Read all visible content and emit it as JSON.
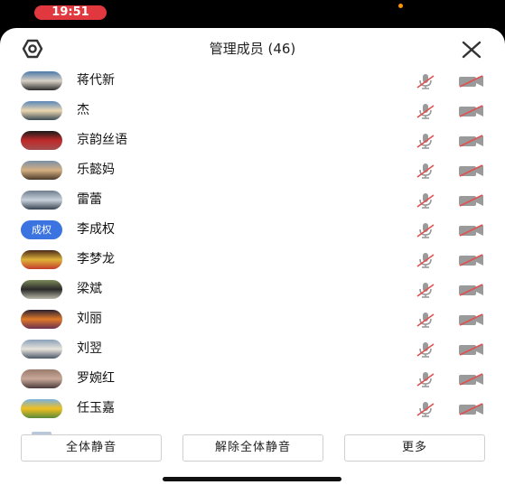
{
  "status_bar": {
    "time": "19:51"
  },
  "header": {
    "title": "管理成员 (46)"
  },
  "members": [
    {
      "name": "蒋代新",
      "avatar_colors": [
        "#4d78a8",
        "#d9d2c6",
        "#2c2c2c"
      ]
    },
    {
      "name": "杰",
      "avatar_colors": [
        "#5a86b8",
        "#ecd7b0",
        "#3b4b57"
      ]
    },
    {
      "name": "京韵丝语",
      "avatar_colors": [
        "#1a1a1a",
        "#c02a2a",
        "#a05050"
      ]
    },
    {
      "name": "乐懿妈",
      "avatar_colors": [
        "#7a8fa6",
        "#d6b083",
        "#4a3a2a"
      ]
    },
    {
      "name": "雷蕾",
      "avatar_colors": [
        "#6e7d8d",
        "#c9d2dc",
        "#364350"
      ]
    },
    {
      "name": "李成权",
      "avatar_text": "成权",
      "avatar_colors": [
        "#3b74e0",
        "#3b74e0",
        "#3b74e0"
      ]
    },
    {
      "name": "李梦龙",
      "avatar_colors": [
        "#4a2a1a",
        "#e0b23a",
        "#c23b2a"
      ]
    },
    {
      "name": "梁斌",
      "avatar_colors": [
        "#7c8a5a",
        "#2a2a2a",
        "#b8b8a8"
      ]
    },
    {
      "name": "刘丽",
      "avatar_colors": [
        "#2a2030",
        "#e07a2a",
        "#6a3050"
      ]
    },
    {
      "name": "刘翌",
      "avatar_colors": [
        "#8aa0b8",
        "#e8e4dc",
        "#4a5868"
      ]
    },
    {
      "name": "罗婉红",
      "avatar_colors": [
        "#9a7a6a",
        "#c8a898",
        "#4a3a3a"
      ]
    },
    {
      "name": "任玉嘉",
      "avatar_colors": [
        "#7ab0e0",
        "#f0c020",
        "#5a8a3a"
      ]
    }
  ],
  "buttons": {
    "mute_all": "全体静音",
    "unmute_all": "解除全体静音",
    "more": "更多"
  },
  "colors": {
    "time_pill": "#e0383e",
    "muted_icon": "#e05050",
    "icon_gray": "#999999"
  }
}
